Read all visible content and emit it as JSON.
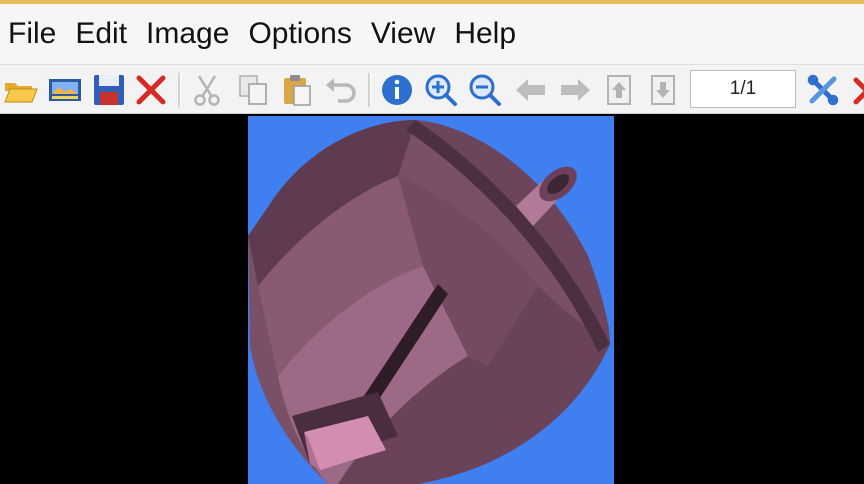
{
  "menu": {
    "items": [
      "File",
      "Edit",
      "Image",
      "Options",
      "View",
      "Help"
    ]
  },
  "toolbar": {
    "buttons": [
      {
        "name": "open-icon"
      },
      {
        "name": "thumbnails-icon"
      },
      {
        "name": "save-icon"
      },
      {
        "name": "delete-icon"
      },
      {
        "name": "cut-icon"
      },
      {
        "name": "copy-icon"
      },
      {
        "name": "paste-icon"
      },
      {
        "name": "undo-icon"
      },
      {
        "name": "info-icon"
      },
      {
        "name": "zoom-in-icon"
      },
      {
        "name": "zoom-out-icon"
      },
      {
        "name": "previous-icon"
      },
      {
        "name": "next-icon"
      },
      {
        "name": "first-page-icon"
      },
      {
        "name": "last-page-icon"
      },
      {
        "name": "settings-icon"
      },
      {
        "name": "exit-icon"
      }
    ],
    "page_indicator": "1/1"
  },
  "colors": {
    "accent": "#e8b85c",
    "canvas_background": "#3f7ff0",
    "viewer_background": "#000000",
    "object_fill": "#7a5068"
  }
}
